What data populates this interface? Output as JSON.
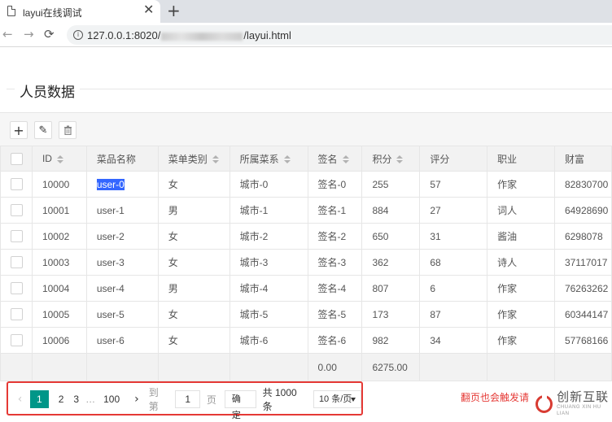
{
  "browser": {
    "tab_title": "layui在线调试",
    "close_glyph": "✕",
    "newtab_glyph": "+",
    "url_prefix": "127.0.0.1:8020/",
    "url_suffix": "/layui.html",
    "info_glyph": "i",
    "back_glyph": "←",
    "forward_glyph": "→",
    "reload_glyph": "⟳"
  },
  "page": {
    "legend": "人员数据"
  },
  "toolbar": {
    "add_glyph": "+",
    "edit_glyph": "✎",
    "delete_glyph": "🗑"
  },
  "table": {
    "columns": [
      {
        "label": "ID",
        "sortable": true
      },
      {
        "label": "菜品名称",
        "sortable": false
      },
      {
        "label": "菜单类别",
        "sortable": true
      },
      {
        "label": "所属菜系",
        "sortable": true
      },
      {
        "label": "签名",
        "sortable": true
      },
      {
        "label": "积分",
        "sortable": true
      },
      {
        "label": "评分",
        "sortable": false
      },
      {
        "label": "职业",
        "sortable": false
      },
      {
        "label": "财富",
        "sortable": false
      }
    ],
    "rows": [
      [
        "10000",
        "user-0",
        "女",
        "城市-0",
        "签名-0",
        "255",
        "57",
        "作家",
        "82830700"
      ],
      [
        "10001",
        "user-1",
        "男",
        "城市-1",
        "签名-1",
        "884",
        "27",
        "词人",
        "64928690"
      ],
      [
        "10002",
        "user-2",
        "女",
        "城市-2",
        "签名-2",
        "650",
        "31",
        "酱油",
        "6298078"
      ],
      [
        "10003",
        "user-3",
        "女",
        "城市-3",
        "签名-3",
        "362",
        "68",
        "诗人",
        "37117017"
      ],
      [
        "10004",
        "user-4",
        "男",
        "城市-4",
        "签名-4",
        "807",
        "6",
        "作家",
        "76263262"
      ],
      [
        "10005",
        "user-5",
        "女",
        "城市-5",
        "签名-5",
        "173",
        "87",
        "作家",
        "60344147"
      ],
      [
        "10006",
        "user-6",
        "女",
        "城市-6",
        "签名-6",
        "982",
        "34",
        "作家",
        "57768166"
      ]
    ],
    "selected_cell": "user-0",
    "totals": {
      "sign": "0.00",
      "score": "6275.00"
    }
  },
  "pager": {
    "prev_glyph": "‹",
    "current": "1",
    "pages": [
      "2",
      "3"
    ],
    "ellipsis": "…",
    "last": "100",
    "next_glyph": "›",
    "skip_label": "到第",
    "skip_value": "1",
    "page_label": "页",
    "confirm_label": "确定",
    "count_text": "共 1000 条",
    "limit_text": "10 条/页"
  },
  "annotation": {
    "note": "翻页也会触发请"
  },
  "watermark": {
    "cn": "创新互联",
    "en": "CHUANG XIN HU LIAN"
  },
  "colors": {
    "accent": "#009688",
    "highlight": "#e53935",
    "selection": "#3366ff"
  }
}
